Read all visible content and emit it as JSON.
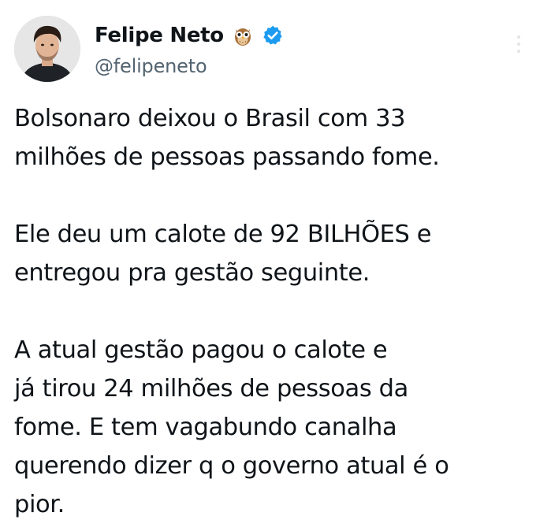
{
  "author": {
    "display_name": "Felipe Neto",
    "handle": "@felipeneto",
    "badge_icon": "owl-emoji-icon",
    "verified_icon": "verified-badge-icon",
    "verified_color": "#1d9bf0"
  },
  "tweet": {
    "paragraphs": [
      {
        "lines": [
          "Bolsonaro deixou o Brasil com 33",
          "milhões de pessoas passando fome."
        ]
      },
      {
        "lines": [
          "Ele deu um calote de 92 BILHÕES e",
          "entregou pra gestão seguinte."
        ]
      },
      {
        "lines": [
          "A atual gestão pagou o calote e",
          "já tirou 24 milhões de pessoas da",
          "fome. E tem vagabundo canalha",
          "querendo dizer q o governo atual é o",
          "pior."
        ]
      }
    ]
  },
  "menu": {
    "icon": "more-options-icon"
  },
  "colors": {
    "text_primary": "#0f1419",
    "text_secondary": "#536471",
    "background": "#ffffff"
  }
}
